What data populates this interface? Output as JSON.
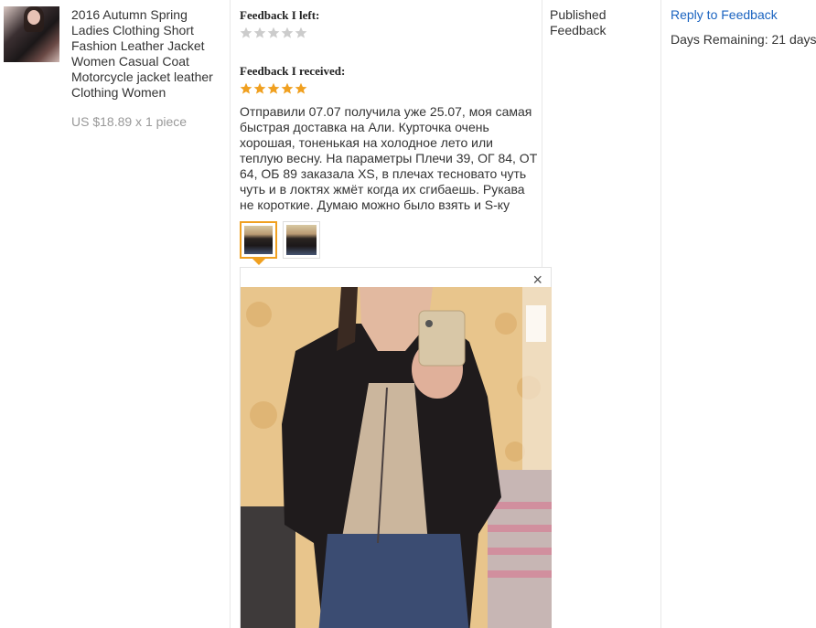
{
  "product": {
    "title": "2016 Autumn Spring Ladies Clothing Short Fashion Leather Jacket Women Casual Coat Motorcycle jacket leather Clothing Women",
    "price": "US $18.89 x 1 piece"
  },
  "feedback_left": {
    "heading": "Feedback I left:",
    "rating": 0,
    "max": 5
  },
  "feedback_received": {
    "heading": "Feedback I received:",
    "rating": 5,
    "max": 5,
    "text": "Отправили 07.07 получила уже 25.07, моя самая быстрая доставка на Али. Курточка очень хорошая, тоненькая на холодное лето или теплую весну. На параметры Плечи 39, ОГ 84, ОТ 64, ОБ 89 заказала XS, в плечах тесновато чуть чуть и в локтях жмёт когда их сгибаешь. Рукава не короткие. Думаю можно было взять и S-ку"
  },
  "photo_preview": {
    "close_glyph": "×",
    "thumbnails": [
      "photo-1",
      "photo-2"
    ],
    "active_index": 0
  },
  "status": {
    "label": "Published Feedback"
  },
  "actions": {
    "reply_label": "Reply to Feedback",
    "days_remaining": "Days Remaining: 21 days"
  },
  "colors": {
    "star_filled": "#f0a020",
    "star_empty": "#cccccc",
    "link": "#1a63c0",
    "accent": "#f0a020"
  },
  "icons": {
    "close": "close-icon",
    "star": "star-icon"
  }
}
